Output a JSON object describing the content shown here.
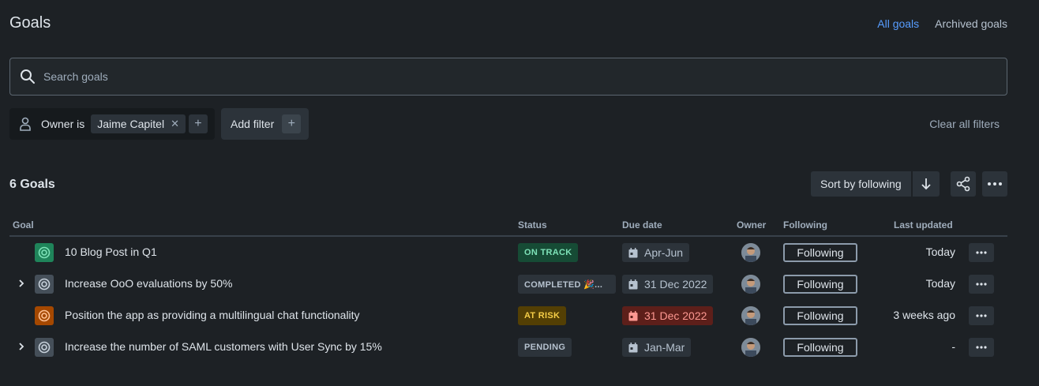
{
  "header": {
    "title": "Goals",
    "links": {
      "all": "All goals",
      "archived": "Archived goals"
    }
  },
  "search": {
    "placeholder": "Search goals",
    "value": ""
  },
  "filters": {
    "owner_label": "Owner is",
    "owner_value": "Jaime Capitel",
    "add_filter": "Add filter",
    "clear_all": "Clear all filters"
  },
  "list": {
    "count": "6 Goals",
    "sort_label": "Sort by following"
  },
  "columns": {
    "goal": "Goal",
    "status": "Status",
    "due": "Due date",
    "owner": "Owner",
    "following": "Following",
    "updated": "Last updated"
  },
  "rows": [
    {
      "name": "10 Blog Post in Q1",
      "status": "ON TRACK",
      "due": "Apr-Jun",
      "following": "Following",
      "updated": "Today",
      "expandable": false,
      "icon_color": "#1f845a",
      "status_bg": "#164b35",
      "status_fg": "#7ee2b8",
      "due_bg": "#2c333a",
      "due_fg": "#b6c2cf"
    },
    {
      "name": "Increase OoO evaluations by 50%",
      "status": "COMPLETED 🎉...",
      "due": "31 Dec 2022",
      "following": "Following",
      "updated": "Today",
      "expandable": true,
      "icon_color": "#454f59",
      "status_bg": "#2c333a",
      "status_fg": "#b6c2cf",
      "due_bg": "#2c333a",
      "due_fg": "#b6c2cf"
    },
    {
      "name": "Position the app as providing a multilingual chat functionality",
      "status": "AT RISK",
      "due": "31 Dec 2022",
      "following": "Following",
      "updated": "3 weeks ago",
      "expandable": false,
      "icon_color": "#a54800",
      "status_bg": "#533f04",
      "status_fg": "#f5cd47",
      "due_bg": "#5d1f1a",
      "due_fg": "#fd9891"
    },
    {
      "name": "Increase the number of SAML customers with User Sync by 15%",
      "status": "PENDING",
      "due": "Jan-Mar",
      "following": "Following",
      "updated": "-",
      "expandable": true,
      "icon_color": "#454f59",
      "status_bg": "#2c333a",
      "status_fg": "#b6c2cf",
      "due_bg": "#2c333a",
      "due_fg": "#b6c2cf"
    }
  ]
}
